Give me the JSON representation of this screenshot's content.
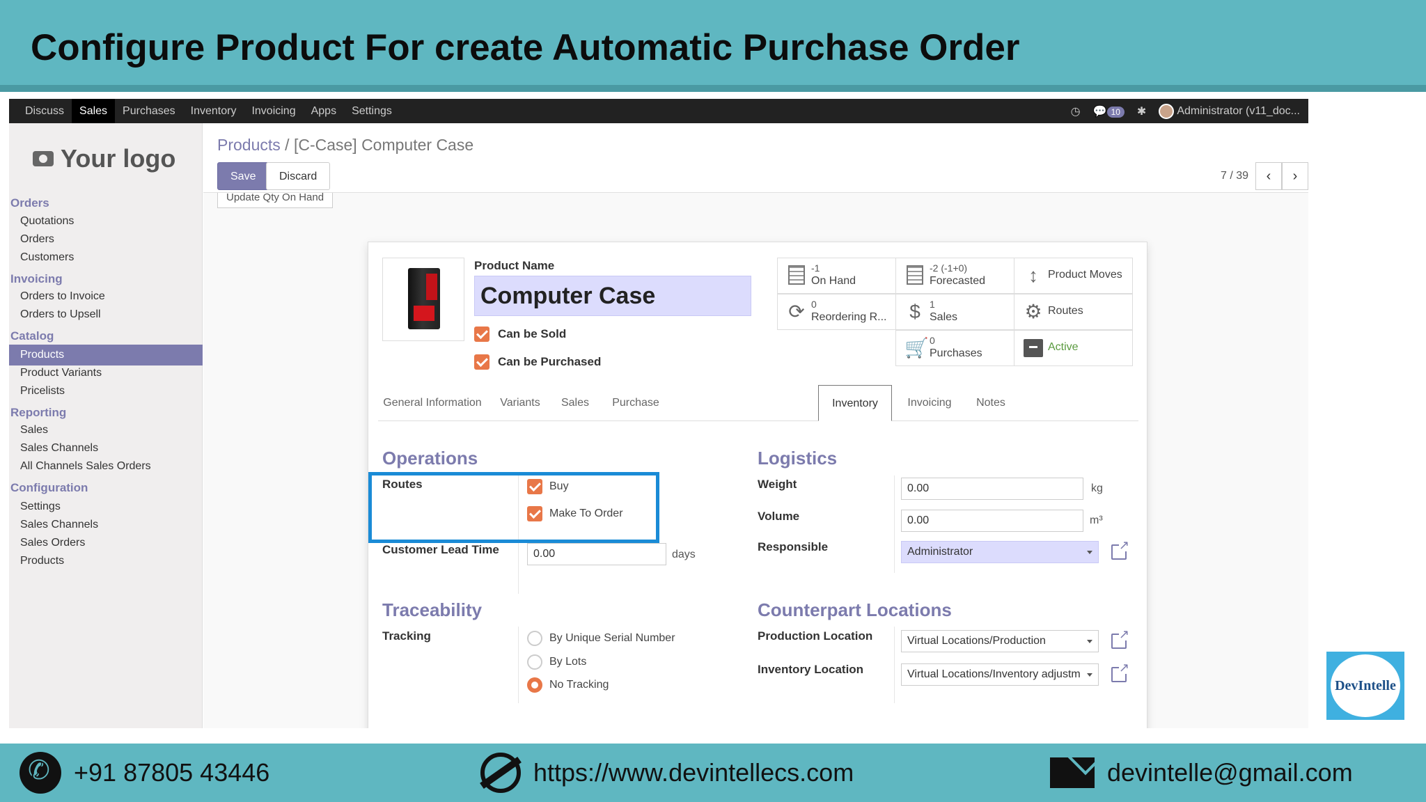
{
  "slide": {
    "title": "Configure Product For create Automatic Purchase Order",
    "footer": {
      "phone": "+91 87805 43446",
      "website": "https://www.devintellecs.com",
      "email": "devintelle@gmail.com"
    },
    "brand_logo_text": "DevIntelle"
  },
  "topbar": {
    "menu": [
      "Discuss",
      "Sales",
      "Purchases",
      "Inventory",
      "Invoicing",
      "Apps",
      "Settings"
    ],
    "active_menu": "Sales",
    "notification_count": "10",
    "user": "Administrator (v11_doc..."
  },
  "sidebar": {
    "logo": "Your logo",
    "sections": [
      {
        "title": "Orders",
        "items": [
          "Quotations",
          "Orders",
          "Customers"
        ]
      },
      {
        "title": "Invoicing",
        "items": [
          "Orders to Invoice",
          "Orders to Upsell"
        ]
      },
      {
        "title": "Catalog",
        "items": [
          "Products",
          "Product Variants",
          "Pricelists"
        ]
      },
      {
        "title": "Reporting",
        "items": [
          "Sales",
          "Sales Channels",
          "All Channels Sales Orders"
        ]
      },
      {
        "title": "Configuration",
        "items": [
          "Settings",
          "Sales Channels",
          "Sales Orders",
          "Products"
        ]
      }
    ],
    "active_item": "Products"
  },
  "control_panel": {
    "breadcrumb_link": "Products",
    "breadcrumb_sep": "/",
    "breadcrumb_current": "[C-Case] Computer Case",
    "save": "Save",
    "discard": "Discard",
    "pager": "7 / 39",
    "stub_button": "Update Qty On Hand"
  },
  "product": {
    "name_label": "Product Name",
    "name": "Computer Case",
    "can_be_sold": "Can be Sold",
    "can_be_purchased": "Can be Purchased"
  },
  "smart_buttons": [
    {
      "value": "-1",
      "label": "On Hand",
      "icon": "building-grid-icon"
    },
    {
      "value": "-2 (-1+0)",
      "label": "Forecasted",
      "icon": "building-grid-icon"
    },
    {
      "value": "",
      "label": "Product Moves",
      "icon": "up-down-arrow-icon"
    },
    {
      "value": "0",
      "label": "Reordering R...",
      "icon": "refresh-icon"
    },
    {
      "value": "1",
      "label": "Sales",
      "icon": "dollar-icon"
    },
    {
      "value": "",
      "label": "Routes",
      "icon": "gears-icon"
    },
    {
      "value": "0",
      "label": "Purchases",
      "icon": "cart-icon"
    },
    {
      "value": "",
      "label": "Active",
      "icon": "archive-icon"
    }
  ],
  "tabs": [
    "General Information",
    "Variants",
    "Sales",
    "Purchase",
    "Inventory",
    "Invoicing",
    "Notes"
  ],
  "active_tab": "Inventory",
  "operations": {
    "title": "Operations",
    "routes_label": "Routes",
    "routes": [
      "Buy",
      "Make To Order"
    ],
    "lead_time_label": "Customer Lead Time",
    "lead_time": "0.00",
    "lead_time_unit": "days"
  },
  "logistics": {
    "title": "Logistics",
    "weight_label": "Weight",
    "weight": "0.00",
    "weight_unit": "kg",
    "volume_label": "Volume",
    "volume": "0.00",
    "volume_unit": "m³",
    "responsible_label": "Responsible",
    "responsible": "Administrator"
  },
  "traceability": {
    "title": "Traceability",
    "tracking_label": "Tracking",
    "options": [
      "By Unique Serial Number",
      "By Lots",
      "No Tracking"
    ],
    "selected": "No Tracking"
  },
  "counterpart": {
    "title": "Counterpart Locations",
    "production_label": "Production Location",
    "production": "Virtual Locations/Production",
    "inventory_label": "Inventory Location",
    "inventory": "Virtual Locations/Inventory adjustm"
  },
  "colors": {
    "slide_teal": "#5fb7c1",
    "odoo_purple": "#7c7bad",
    "checkbox_orange": "#e87748",
    "highlight_blue": "#1a8bd6"
  }
}
